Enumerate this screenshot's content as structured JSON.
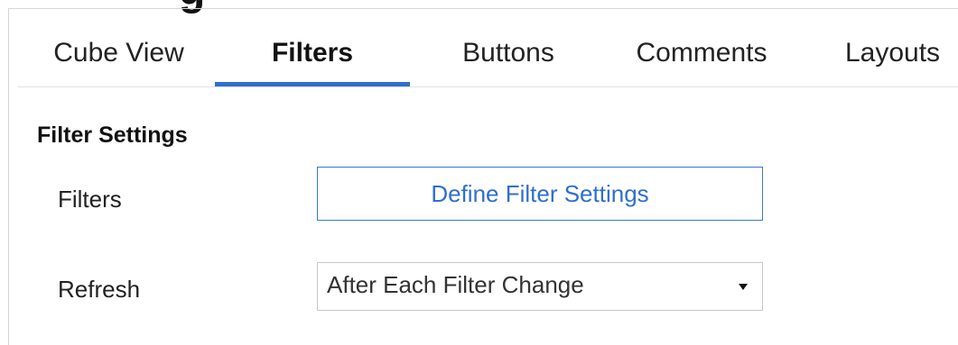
{
  "clipped_heading": "g",
  "tabs": [
    {
      "label": "Cube View",
      "active": false
    },
    {
      "label": "Filters",
      "active": true
    },
    {
      "label": "Buttons",
      "active": false
    },
    {
      "label": "Comments",
      "active": false
    },
    {
      "label": "Layouts",
      "active": false
    }
  ],
  "colors": {
    "accent": "#2f6fd0",
    "divider": "#e2e2e2"
  },
  "filter_settings": {
    "title": "Filter Settings",
    "filters_label": "Filters",
    "define_button_label": "Define Filter Settings",
    "refresh_label": "Refresh",
    "refresh_value": "After Each Filter Change",
    "refresh_dropdown_icon": "caret-down-icon"
  }
}
